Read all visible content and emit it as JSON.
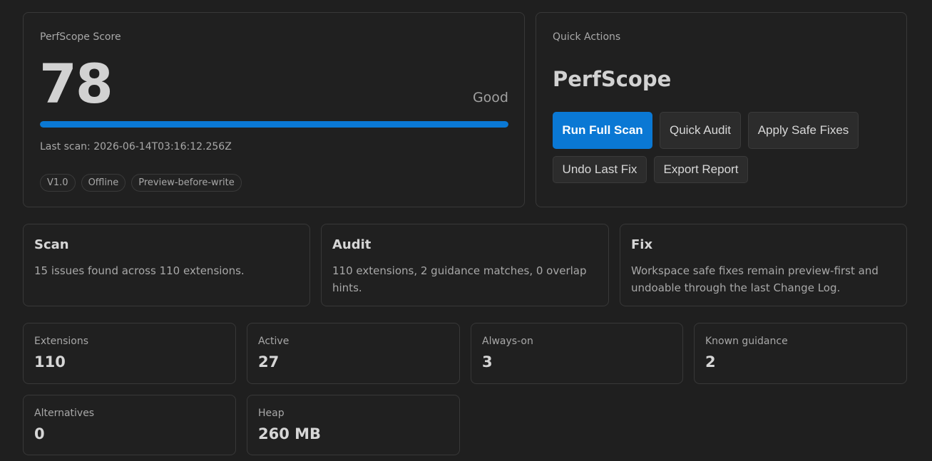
{
  "score": {
    "label": "PerfScope Score",
    "value": "78",
    "rating": "Good",
    "progress_percent": 100,
    "last_scan_label": "Last scan: ",
    "last_scan_value": "2026-06-14T03:16:12.256Z",
    "chips": [
      "V1.0",
      "Offline",
      "Preview-before-write"
    ]
  },
  "actions": {
    "label": "Quick Actions",
    "app_name": "PerfScope",
    "run_full_scan": "Run Full Scan",
    "quick_audit": "Quick Audit",
    "apply_safe_fixes": "Apply Safe Fixes",
    "undo_last_fix": "Undo Last Fix",
    "export_report": "Export Report"
  },
  "summaries": {
    "scan": {
      "title": "Scan",
      "text": "15 issues found across 110 extensions."
    },
    "audit": {
      "title": "Audit",
      "text": "110 extensions, 2 guidance matches, 0 overlap hints."
    },
    "fix": {
      "title": "Fix",
      "text": "Workspace safe fixes remain preview-first and undoable through the last Change Log."
    }
  },
  "stats": {
    "extensions": {
      "label": "Extensions",
      "value": "110"
    },
    "active": {
      "label": "Active",
      "value": "27"
    },
    "always_on": {
      "label": "Always-on",
      "value": "3"
    },
    "known_guidance": {
      "label": "Known guidance",
      "value": "2"
    },
    "alternatives": {
      "label": "Alternatives",
      "value": "0"
    },
    "heap": {
      "label": "Heap",
      "value": "260 MB"
    }
  },
  "colors": {
    "accent": "#0a78d4",
    "background": "#1f1f1f",
    "card_border": "#383838"
  }
}
